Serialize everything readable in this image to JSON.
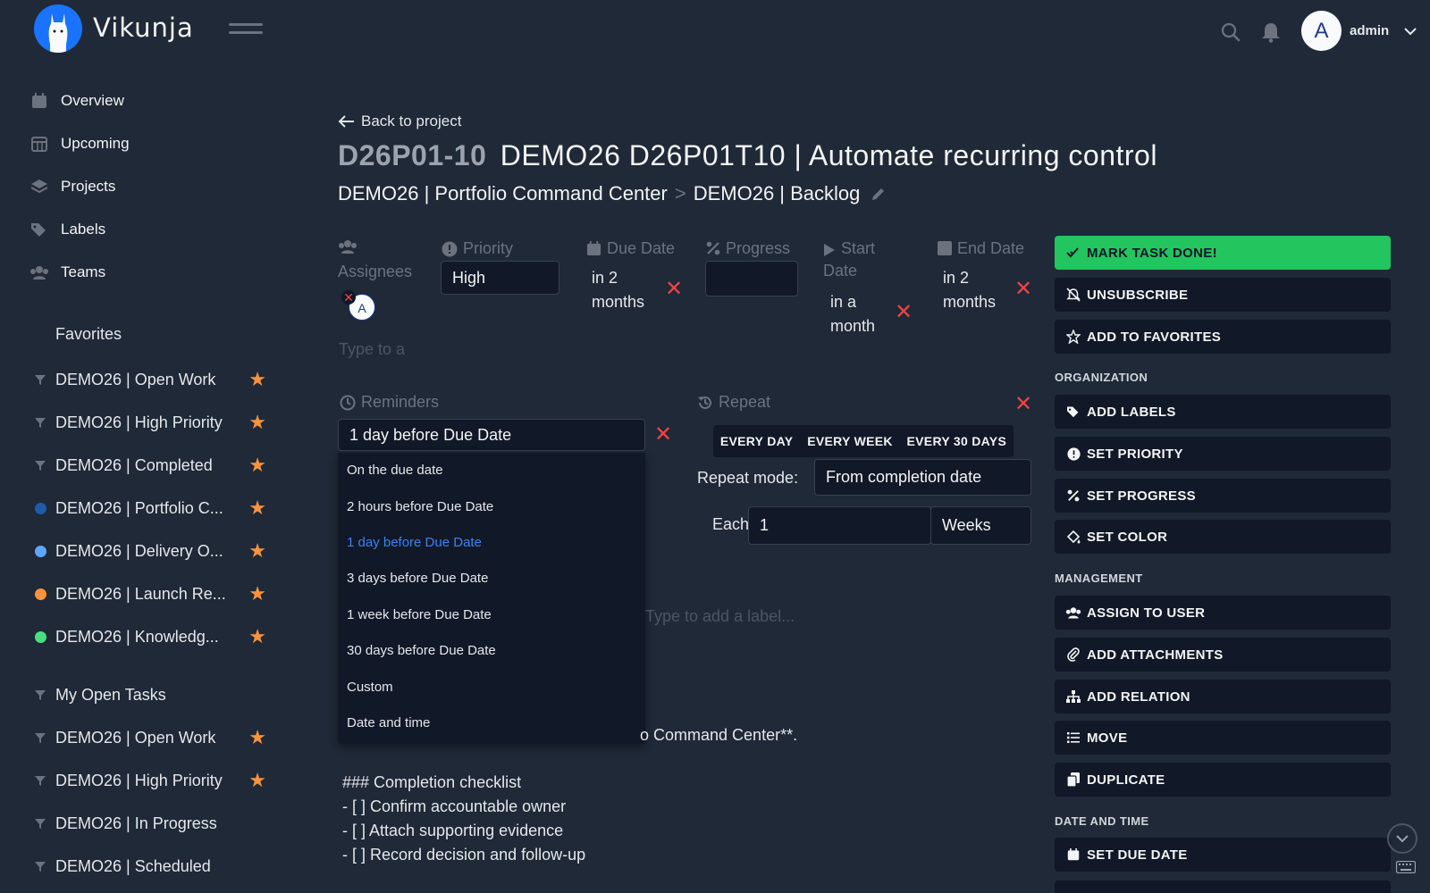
{
  "app": {
    "name": "Vikunja",
    "user_initial": "A",
    "user_name": "admin"
  },
  "nav": [
    {
      "label": "Overview",
      "icon": "calendar-icon"
    },
    {
      "label": "Upcoming",
      "icon": "calendar-grid-icon"
    },
    {
      "label": "Projects",
      "icon": "layers-icon"
    },
    {
      "label": "Labels",
      "icon": "tags-icon"
    },
    {
      "label": "Teams",
      "icon": "users-icon"
    }
  ],
  "sidebar": {
    "favorites_title": "Favorites",
    "favorites": [
      {
        "label": "DEMO26 | Open Work",
        "kind": "filter"
      },
      {
        "label": "DEMO26 | High Priority",
        "kind": "filter"
      },
      {
        "label": "DEMO26 | Completed",
        "kind": "filter"
      },
      {
        "label": "DEMO26 | Portfolio C...",
        "kind": "dot",
        "color": "#1e5ba8"
      },
      {
        "label": "DEMO26 | Delivery O...",
        "kind": "dot",
        "color": "#60a5fa"
      },
      {
        "label": "DEMO26 | Launch Re...",
        "kind": "dot",
        "color": "#fb923c"
      },
      {
        "label": "DEMO26 | Knowledg...",
        "kind": "dot",
        "color": "#4ade80"
      }
    ],
    "my_open_tasks": "My Open Tasks",
    "filters": [
      {
        "label": "DEMO26 | Open Work",
        "starred": true
      },
      {
        "label": "DEMO26 | High Priority",
        "starred": true
      },
      {
        "label": "DEMO26 | In Progress",
        "starred": false
      },
      {
        "label": "DEMO26 | Scheduled",
        "starred": false
      }
    ]
  },
  "task": {
    "back_label": "Back to project",
    "identifier": "D26P01-10",
    "title": "DEMO26 D26P01T10 | Automate recurring control",
    "breadcrumb_project": "DEMO26 | Portfolio Command Center",
    "breadcrumb_separator": ">",
    "breadcrumb_bucket": "DEMO26 | Backlog",
    "fields": {
      "assignees_label": "Assignees",
      "assignee_initial": "A",
      "assignee_placeholder": "Type to a",
      "priority_label": "Priority",
      "priority_value": "High",
      "due_label": "Due Date",
      "due_value_1": "in 2",
      "due_value_2": "months",
      "progress_label": "Progress",
      "start_label_1": "Start",
      "start_label_2": "Date",
      "start_value_1": "in a",
      "start_value_2": "month",
      "end_label": "End Date",
      "end_value_1": "in 2",
      "end_value_2": "months"
    },
    "reminders": {
      "label": "Reminders",
      "selected": "1 day before Due Date",
      "options": [
        "On the due date",
        "2 hours before Due Date",
        "1 day before Due Date",
        "3 days before Due Date",
        "1 week before Due Date",
        "30 days before Due Date",
        "Custom",
        "Date and time"
      ]
    },
    "repeat": {
      "label": "Repeat",
      "buttons": [
        "EVERY DAY",
        "EVERY WEEK",
        "EVERY 30 DAYS"
      ],
      "mode_label": "Repeat mode:",
      "mode_value": "From completion date",
      "each_label": "Each",
      "each_value": "1",
      "unit_value": "Weeks"
    },
    "label_placeholder": "Type to add a label...",
    "description": {
      "partial_line": "o Command Center**.",
      "checklist_title": "### Completion checklist",
      "items": [
        "- [ ] Confirm accountable owner",
        "- [ ] Attach supporting evidence",
        "- [ ] Record decision and follow-up"
      ]
    }
  },
  "actions": {
    "mark_done": "MARK TASK DONE!",
    "unsubscribe": "UNSUBSCRIBE",
    "add_favorites": "ADD TO FAVORITES",
    "organization_title": "ORGANIZATION",
    "add_labels": "ADD LABELS",
    "set_priority": "SET PRIORITY",
    "set_progress": "SET PROGRESS",
    "set_color": "SET COLOR",
    "management_title": "MANAGEMENT",
    "assign_user": "ASSIGN TO USER",
    "add_attachments": "ADD ATTACHMENTS",
    "add_relation": "ADD RELATION",
    "move": "MOVE",
    "duplicate": "DUPLICATE",
    "datetime_title": "DATE AND TIME",
    "set_due_date": "SET DUE DATE"
  },
  "colors": {
    "accent": "#1973ff",
    "done": "#22c55e",
    "danger": "#ef4444",
    "star": "#fb923c",
    "link": "#3b82f6"
  }
}
